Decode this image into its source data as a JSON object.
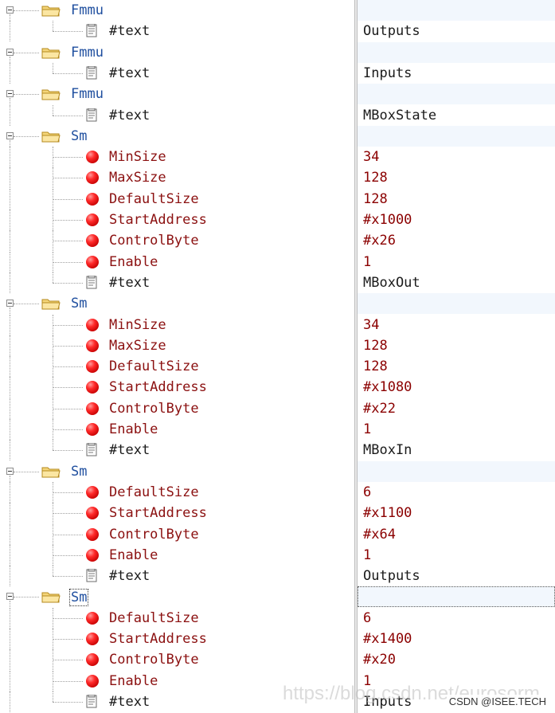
{
  "tree": {
    "rows": [
      {
        "kind": "element",
        "label": "Fmmu",
        "value": ""
      },
      {
        "kind": "text",
        "label": "#text",
        "value": "Outputs"
      },
      {
        "kind": "element",
        "label": "Fmmu",
        "value": ""
      },
      {
        "kind": "text",
        "label": "#text",
        "value": "Inputs"
      },
      {
        "kind": "element",
        "label": "Fmmu",
        "value": ""
      },
      {
        "kind": "text",
        "label": "#text",
        "value": "MBoxState"
      },
      {
        "kind": "element",
        "label": "Sm",
        "value": ""
      },
      {
        "kind": "attribute",
        "label": "MinSize",
        "value": "34"
      },
      {
        "kind": "attribute",
        "label": "MaxSize",
        "value": "128"
      },
      {
        "kind": "attribute",
        "label": "DefaultSize",
        "value": "128"
      },
      {
        "kind": "attribute",
        "label": "StartAddress",
        "value": "#x1000"
      },
      {
        "kind": "attribute",
        "label": "ControlByte",
        "value": "#x26"
      },
      {
        "kind": "attribute",
        "label": "Enable",
        "value": "1"
      },
      {
        "kind": "text",
        "label": "#text",
        "value": "MBoxOut"
      },
      {
        "kind": "element",
        "label": "Sm",
        "value": ""
      },
      {
        "kind": "attribute",
        "label": "MinSize",
        "value": "34"
      },
      {
        "kind": "attribute",
        "label": "MaxSize",
        "value": "128"
      },
      {
        "kind": "attribute",
        "label": "DefaultSize",
        "value": "128"
      },
      {
        "kind": "attribute",
        "label": "StartAddress",
        "value": "#x1080"
      },
      {
        "kind": "attribute",
        "label": "ControlByte",
        "value": "#x22"
      },
      {
        "kind": "attribute",
        "label": "Enable",
        "value": "1"
      },
      {
        "kind": "text",
        "label": "#text",
        "value": "MBoxIn"
      },
      {
        "kind": "element",
        "label": "Sm",
        "value": ""
      },
      {
        "kind": "attribute",
        "label": "DefaultSize",
        "value": "6"
      },
      {
        "kind": "attribute",
        "label": "StartAddress",
        "value": "#x1100"
      },
      {
        "kind": "attribute",
        "label": "ControlByte",
        "value": "#x64"
      },
      {
        "kind": "attribute",
        "label": "Enable",
        "value": "1"
      },
      {
        "kind": "text",
        "label": "#text",
        "value": "Outputs"
      },
      {
        "kind": "element",
        "label": "Sm",
        "value": "",
        "selected": true
      },
      {
        "kind": "attribute",
        "label": "DefaultSize",
        "value": "6"
      },
      {
        "kind": "attribute",
        "label": "StartAddress",
        "value": "#x1400"
      },
      {
        "kind": "attribute",
        "label": "ControlByte",
        "value": "#x20"
      },
      {
        "kind": "attribute",
        "label": "Enable",
        "value": "1"
      },
      {
        "kind": "text",
        "label": "#text",
        "value": "Inputs"
      }
    ]
  },
  "icons": {
    "expand_toggle": "collapse-toggle-icon",
    "element": "folder-icon",
    "attribute": "red-ball-icon",
    "text": "document-icon"
  },
  "colors": {
    "element_label": "#1f4f9f",
    "attribute_label": "#8b1010",
    "value_text": "#1a1a1a",
    "shaded_value_row": "#f2f7fd"
  },
  "watermark": "https://blog.csdn.net/eurosorm",
  "brand": "CSDN @ISEE.TECH"
}
